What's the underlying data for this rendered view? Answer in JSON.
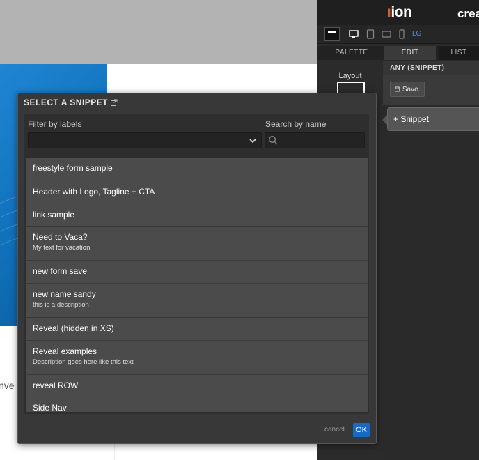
{
  "background_page": {
    "partial_text": "nve"
  },
  "editor": {
    "logo": "ion",
    "brand_partial": "crea",
    "device_size": "LG",
    "tabs": [
      "PALETTE",
      "EDIT",
      "LIST"
    ],
    "palette_label": "Layout",
    "section_title": "ANY (SNIPPET)",
    "save_label": "Save...",
    "add_snippet_label": "+ Snippet"
  },
  "modal": {
    "title": "SELECT A SNIPPET",
    "filter_label": "Filter by labels",
    "search_label": "Search by name",
    "search_value": "",
    "filter_value": "",
    "snippets": [
      {
        "name": "freestyle form sample",
        "description": ""
      },
      {
        "name": "Header with Logo, Tagline + CTA",
        "description": ""
      },
      {
        "name": "link sample",
        "description": ""
      },
      {
        "name": "Need to Vaca?",
        "description": "My text for vacation"
      },
      {
        "name": "new form save",
        "description": ""
      },
      {
        "name": "new name sandy",
        "description": "this is a description"
      },
      {
        "name": "Reveal (hidden in XS)",
        "description": ""
      },
      {
        "name": "Reveal examples",
        "description": "Description goes here like this text"
      },
      {
        "name": "reveal ROW",
        "description": ""
      },
      {
        "name": "Side Nav",
        "description": ""
      }
    ],
    "cancel_label": "cancel",
    "ok_label": "OK"
  },
  "colors": {
    "accent": "#1769c7",
    "brand_dot": "#e25a25",
    "modal_bg": "#383838",
    "row_bg": "#4b4b4b",
    "editor_bg": "#2b2b2b"
  }
}
